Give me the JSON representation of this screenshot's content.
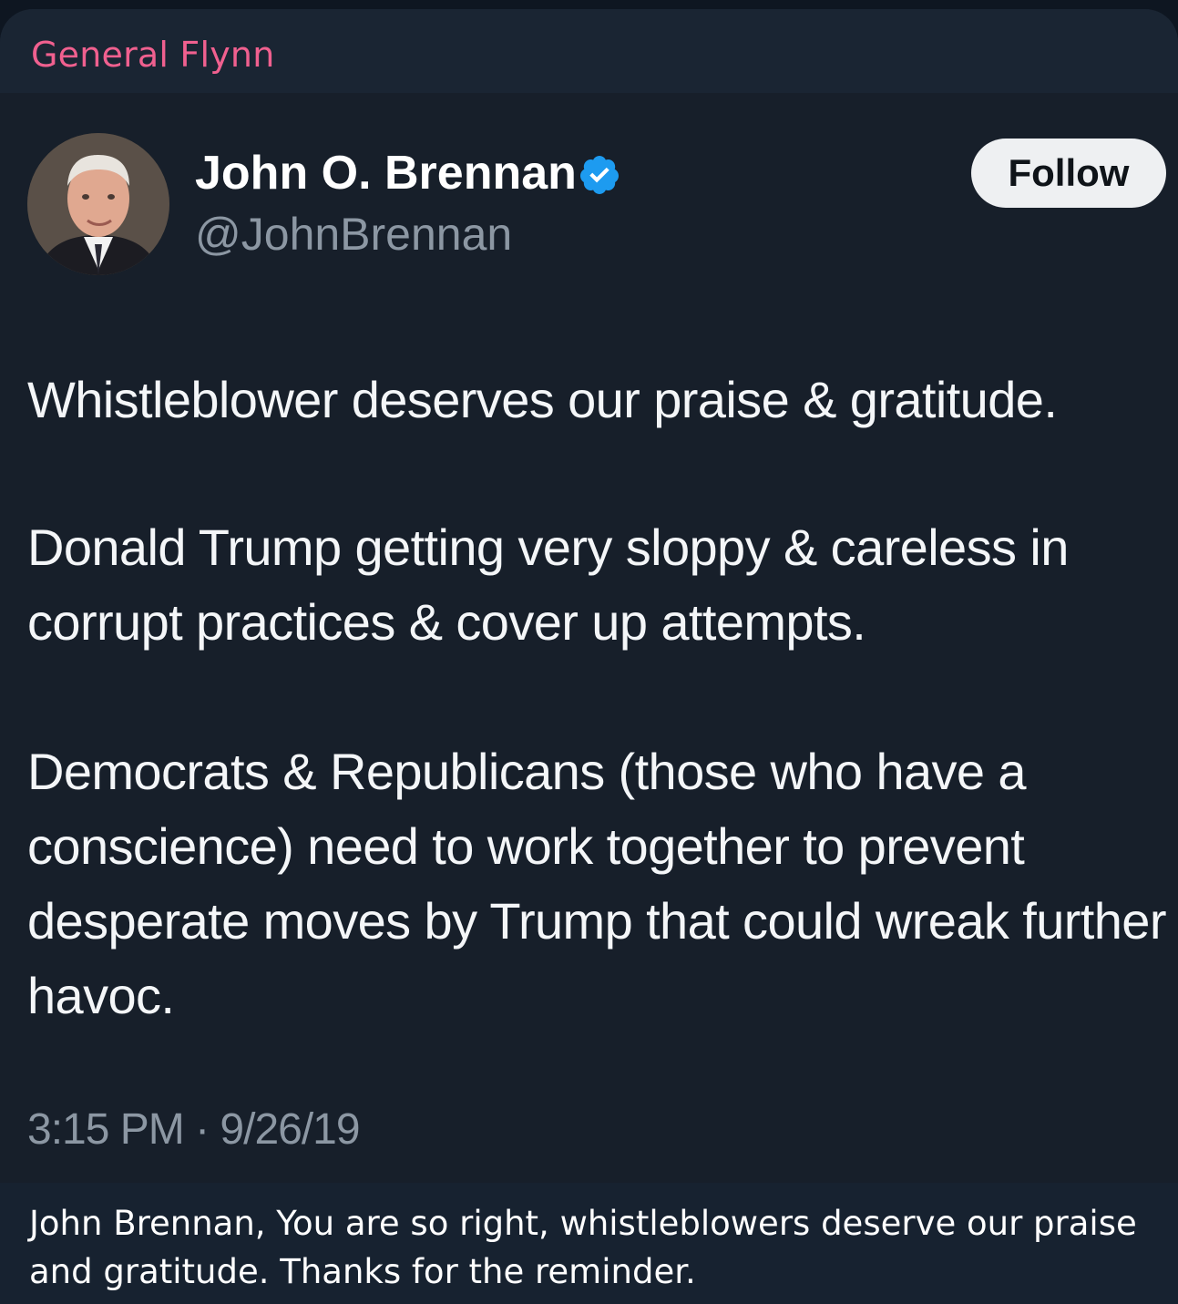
{
  "message": {
    "sender": "General Flynn",
    "caption": "John Brennan, You are so right, whistleblowers deserve our praise and gratitude. Thanks for the reminder."
  },
  "tweet": {
    "display_name": "John O. Brennan",
    "handle": "@JohnBrennan",
    "follow_label": "Follow",
    "paragraphs": [
      "Whistleblower deserves our praise & gratitude.",
      "Donald Trump getting very sloppy & careless in corrupt practices & cover up attempts.",
      "Democrats & Republicans (those who have a conscience) need to work together to prevent desperate moves by Trump that could wreak further havoc."
    ],
    "timestamp": "3:15 PM · 9/26/19",
    "verified_icon": "verified-badge-icon",
    "verified_color": "#1d9bf0"
  },
  "colors": {
    "sender_name": "#f0608f",
    "background": "#171f2a"
  }
}
